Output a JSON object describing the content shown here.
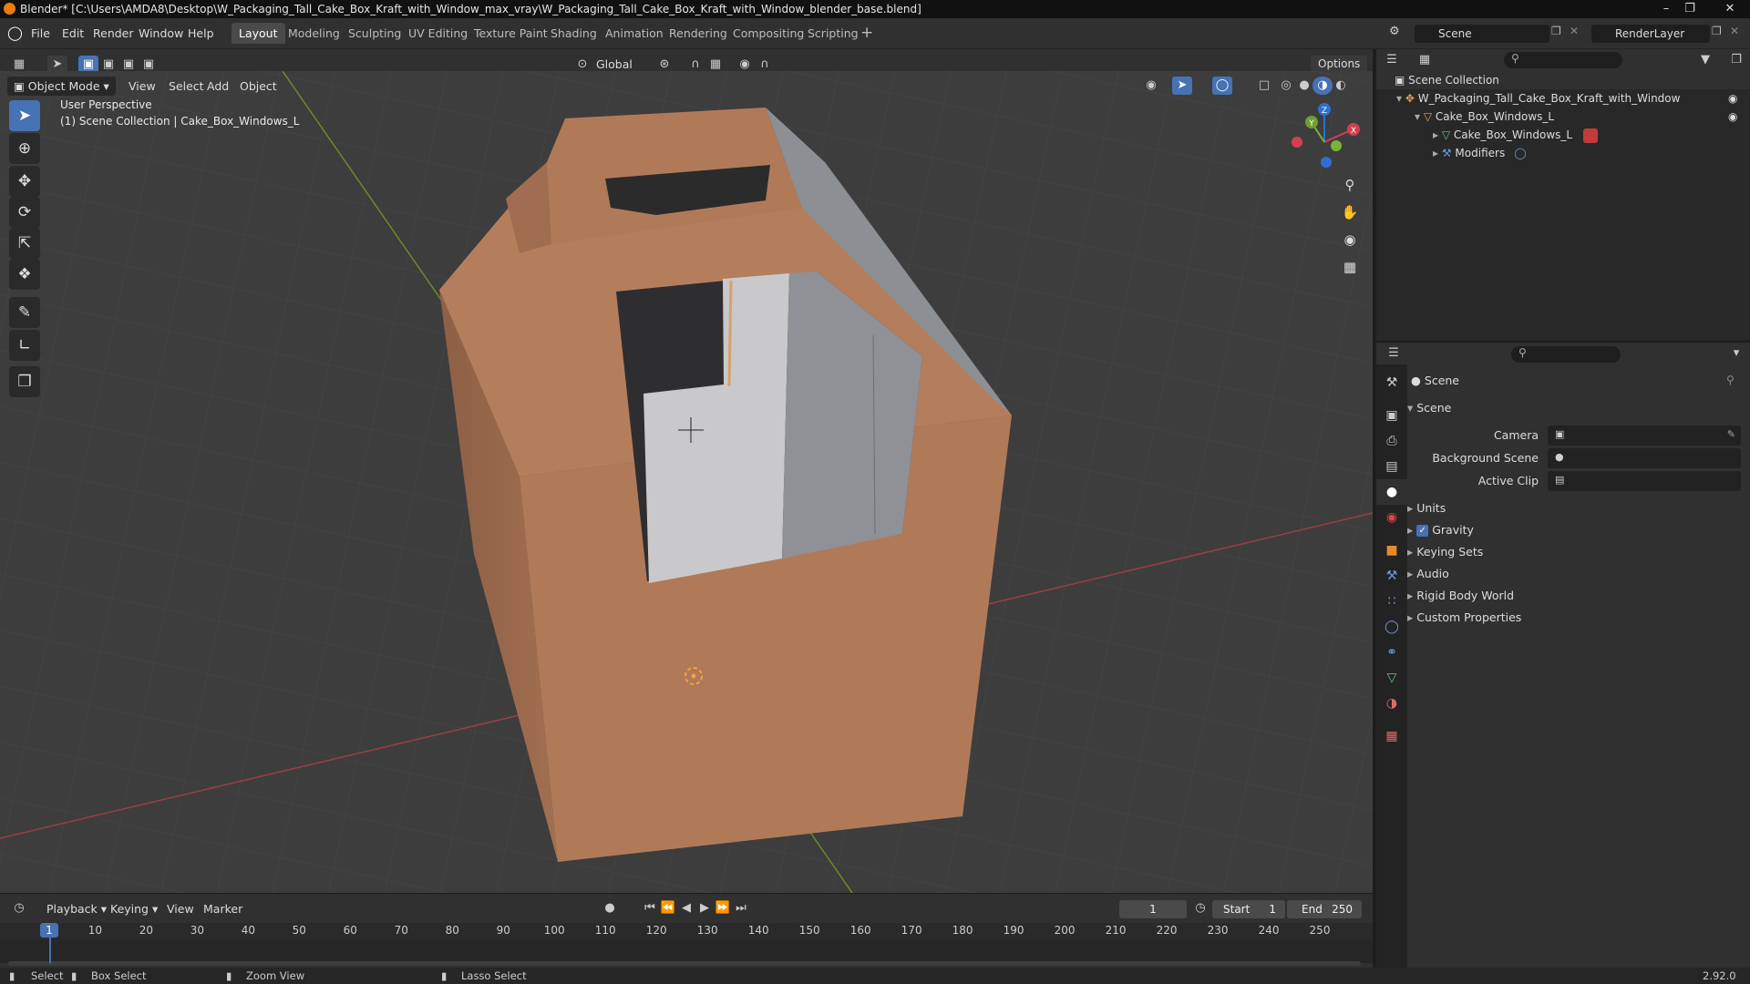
{
  "title": "Blender* [C:\\Users\\AMDA8\\Desktop\\W_Packaging_Tall_Cake_Box_Kraft_with_Window_max_vray\\W_Packaging_Tall_Cake_Box_Kraft_with_Window_blender_base.blend]",
  "menus": [
    "File",
    "Edit",
    "Render",
    "Window",
    "Help"
  ],
  "workspaces": [
    "Layout",
    "Modeling",
    "Sculpting",
    "UV Editing",
    "Texture Paint",
    "Shading",
    "Animation",
    "Rendering",
    "Compositing",
    "Scripting"
  ],
  "active_workspace": "Layout",
  "scene_field": "Scene",
  "renderlayer_field": "RenderLayer",
  "toolbar": {
    "transform": "Global",
    "options": "Options"
  },
  "viewport_header": {
    "mode": "Object Mode",
    "view": "View",
    "select": "Select",
    "add": "Add",
    "object": "Object"
  },
  "overlay_text": {
    "line1": "User Perspective",
    "line2": "(1) Scene Collection | Cake_Box_Windows_L"
  },
  "gizmo": {
    "x": "X",
    "y": "Y",
    "z": "Z"
  },
  "outliner": {
    "root": "Scene Collection",
    "items": [
      {
        "label": "W_Packaging_Tall_Cake_Box_Kraft_with_Window"
      },
      {
        "label": "Cake_Box_Windows_L"
      },
      {
        "label": "Cake_Box_Windows_L"
      },
      {
        "label": "Modifiers"
      }
    ]
  },
  "properties": {
    "header": "Scene",
    "panel": "Scene",
    "camera_label": "Camera",
    "background_scene_label": "Background Scene",
    "active_clip_label": "Active Clip",
    "sections": [
      "Units",
      "Gravity",
      "Keying Sets",
      "Audio",
      "Rigid Body World",
      "Custom Properties"
    ],
    "gravity_checked": true
  },
  "timeline": {
    "playback": "Playback",
    "keying": "Keying",
    "view": "View",
    "marker": "Marker",
    "current_frame": "1",
    "start_label": "Start",
    "start": "1",
    "end_label": "End",
    "end": "250",
    "frame_ticks": [
      "1",
      "10",
      "20",
      "30",
      "40",
      "50",
      "60",
      "70",
      "80",
      "90",
      "100",
      "110",
      "120",
      "130",
      "140",
      "150",
      "160",
      "170",
      "180",
      "190",
      "200",
      "210",
      "220",
      "230",
      "240",
      "250"
    ]
  },
  "statusbar": {
    "select": "Select",
    "box_select": "Box Select",
    "zoom_view": "Zoom View",
    "lasso_select": "Lasso Select",
    "version": "2.92.0"
  },
  "colors": {
    "accent": "#4772b3",
    "box": "#b07a59",
    "box_dark": "#9a684b",
    "inner": "#c9c9cc",
    "active_tab": "#4a4a4a"
  }
}
